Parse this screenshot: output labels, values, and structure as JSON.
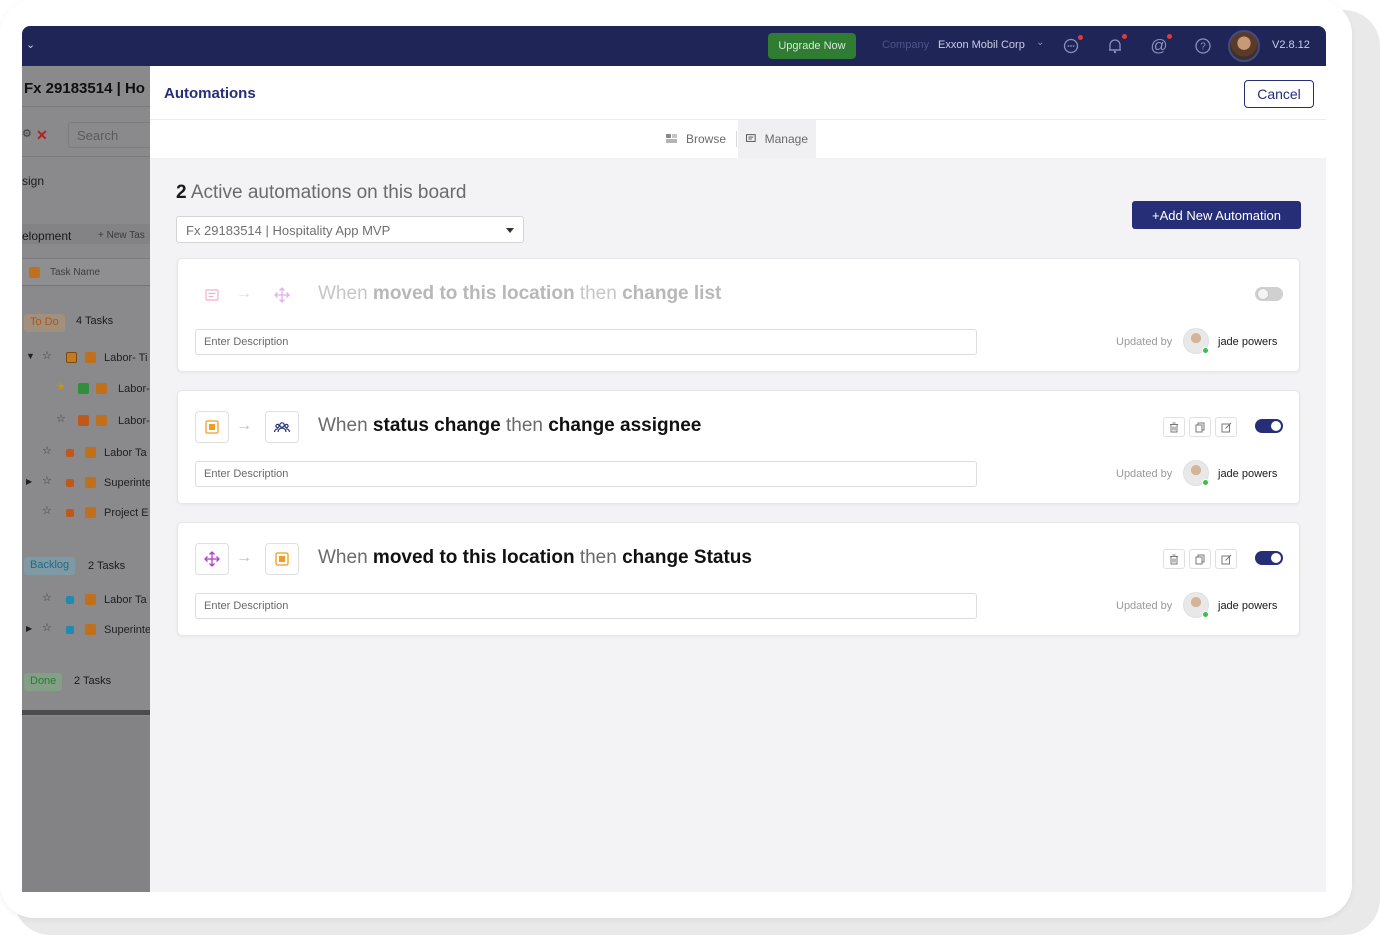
{
  "topbar": {
    "upgrade_label": "Upgrade Now",
    "company_label": "Company",
    "company_value": "Exxon Mobil Corp",
    "version": "V2.8.12",
    "icons": [
      "chat-icon",
      "bell-icon",
      "at-icon",
      "help-icon"
    ]
  },
  "left_panel": {
    "board_title": "Fx 29183514 | Ho",
    "search_placeholder": "Search",
    "section_sign": "sign",
    "section_development": "elopment",
    "new_task_label": "+ New Tas",
    "task_name_header": "Task Name",
    "groups": [
      {
        "label": "To Do",
        "count": "4 Tasks",
        "color": "#c0701a"
      },
      {
        "label": "Backlog",
        "count": "2 Tasks",
        "color": "#1e8cae"
      },
      {
        "label": "Done",
        "count": "2 Tasks",
        "color": "#2f8f3a"
      }
    ],
    "rows": [
      "Labor- Ti",
      "Labor-",
      "Labor-",
      "Labor Ta",
      "Superinte",
      "Project E",
      "Labor Ta",
      "Superinte"
    ]
  },
  "modal": {
    "title": "Automations",
    "cancel_label": "Cancel",
    "tabs": [
      {
        "label": "Browse",
        "icon": "grid-icon",
        "active": false
      },
      {
        "label": "Manage",
        "icon": "manage-icon",
        "active": true
      }
    ],
    "active_count": "2",
    "active_text": "Active automations on this board",
    "board_select_value": "Fx 29183514 | Hospitality App MVP",
    "add_button_label": "+Add New Automation",
    "updated_by_label": "Updated by",
    "description_placeholder": "Enter Description",
    "automations": [
      {
        "when": "When",
        "trigger": "moved to this location",
        "then": "then",
        "action": "change list",
        "enabled": false,
        "trigger_icon": "list-icon",
        "action_icon": "move-icon",
        "updated_by": "jade powers"
      },
      {
        "when": "When",
        "trigger": "status change",
        "then": "then",
        "action": "change assignee",
        "enabled": true,
        "trigger_icon": "status-icon",
        "action_icon": "users-icon",
        "updated_by": "jade powers"
      },
      {
        "when": "When",
        "trigger": "moved to this location",
        "then": "then",
        "action": "change Status",
        "enabled": true,
        "trigger_icon": "move-icon",
        "action_icon": "status-icon",
        "updated_by": "jade powers"
      }
    ],
    "colors": {
      "brand": "#262e78",
      "topbar": "#1f2557",
      "upgrade": "#2e7d32",
      "status_orange": "#f39a21",
      "move_purple": "#b23cc8"
    }
  }
}
